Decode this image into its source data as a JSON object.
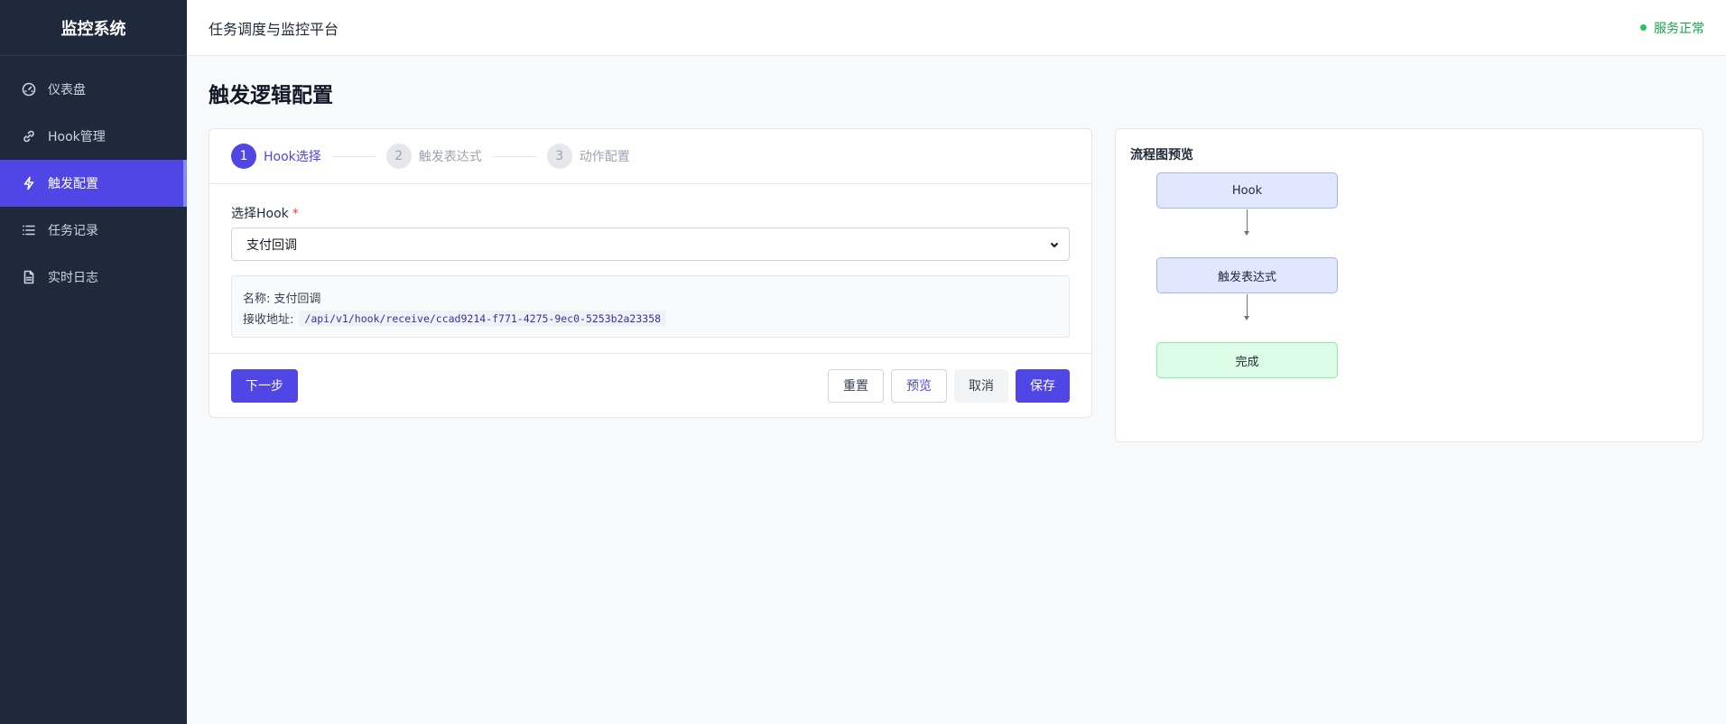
{
  "sidebar": {
    "brand": "监控系统",
    "items": [
      {
        "label": "仪表盘",
        "icon": "gauge-icon"
      },
      {
        "label": "Hook管理",
        "icon": "link-icon"
      },
      {
        "label": "触发配置",
        "icon": "lightning-icon",
        "active": true
      },
      {
        "label": "任务记录",
        "icon": "list-icon"
      },
      {
        "label": "实时日志",
        "icon": "document-icon"
      }
    ]
  },
  "header": {
    "title": "任务调度与监控平台",
    "status": "服务正常"
  },
  "main": {
    "page_title": "触发逻辑配置",
    "steps": [
      {
        "num": "1",
        "label": "Hook选择"
      },
      {
        "num": "2",
        "label": "触发表达式"
      },
      {
        "num": "3",
        "label": "动作配置"
      }
    ],
    "form": {
      "select_label": "选择Hook",
      "required_mark": "*",
      "selected_value": "支付回调",
      "info": {
        "name_label": "名称:",
        "name_value": "支付回调",
        "url_label": "接收地址:",
        "url_value": "/api/v1/hook/receive/ccad9214-f771-4275-9ec0-5253b2a23358"
      }
    },
    "actions": {
      "next": "下一步",
      "reset": "重置",
      "preview": "预览",
      "cancel": "取消",
      "save": "保存"
    }
  },
  "preview": {
    "title": "流程图预览",
    "nodes": [
      "Hook",
      "触发表达式",
      "完成"
    ]
  },
  "colors": {
    "accent": "#4f46e5",
    "sidebar_bg": "#1e293b",
    "status_ok": "#16a34a"
  }
}
